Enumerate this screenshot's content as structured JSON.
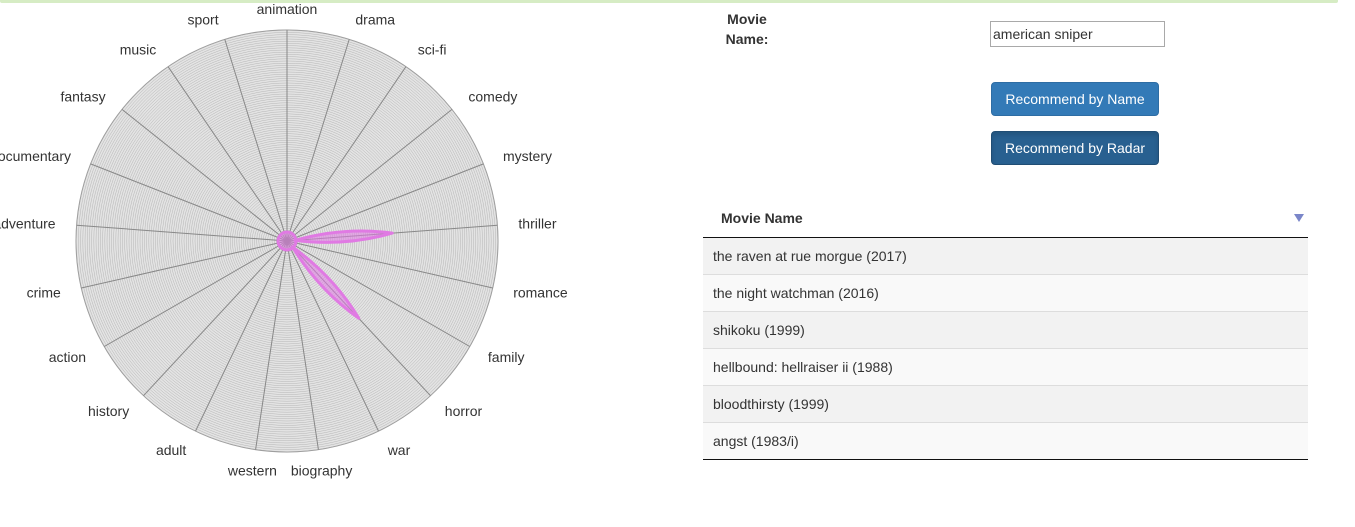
{
  "form": {
    "name_label": "Movie Name:",
    "name_value": "american sniper",
    "recommend_by_name": "Recommend by Name",
    "recommend_by_radar": "Recommend by Radar"
  },
  "radar": {
    "genres": [
      "animation",
      "drama",
      "sci-fi",
      "comedy",
      "mystery",
      "thriller",
      "romance",
      "family",
      "horror",
      "war",
      "biography",
      "western",
      "adult",
      "history",
      "action",
      "crime",
      "adventure",
      "documentary",
      "fantasy",
      "music",
      "sport"
    ],
    "highlight_color": "#e07ae3",
    "values": {
      "animation": 0,
      "drama": 0,
      "sci-fi": 0,
      "comedy": 0,
      "mystery": 0,
      "thriller": 0.5,
      "romance": 0,
      "family": 0,
      "horror": 0.5,
      "war": 0,
      "biography": 0,
      "western": 0,
      "adult": 0,
      "history": 0,
      "action": 0,
      "crime": 0,
      "adventure": 0,
      "documentary": 0,
      "fantasy": 0,
      "music": 0,
      "sport": 0
    }
  },
  "table": {
    "header": "Movie Name",
    "rows": [
      "the raven at rue morgue (2017)",
      "the night watchman (2016)",
      "shikoku (1999)",
      "hellbound: hellraiser ii (1988)",
      "bloodthirsty (1999)",
      "angst (1983/i)"
    ]
  }
}
